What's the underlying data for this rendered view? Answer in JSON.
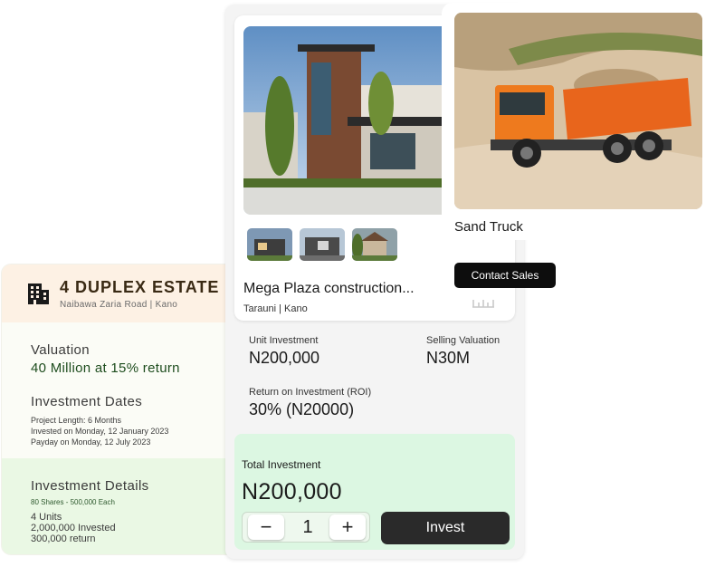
{
  "estate": {
    "title": "4 DUPLEX ESTATE",
    "subtitle": "Naibawa Zaria Road | Kano",
    "icon": "building-icon",
    "valuation_label": "Valuation",
    "valuation_value": "40 Million at 15% return",
    "dates_label": "Investment Dates",
    "project_length": "Project Length: 6 Months",
    "invested_on": "Invested on Monday, 12 January 2023",
    "payday": "Payday on Monday, 12 July 2023",
    "details_label": "Investment Details",
    "shares": "80 Shares -  500,000 Each",
    "units": "4 Units",
    "invested": "2,000,000 Invested",
    "return": "300,000 return"
  },
  "product": {
    "name": "Mega Plaza construction...",
    "location": "Tarauni | Kano",
    "unit_investment_label": "Unit Investment",
    "unit_investment_value": "N200,000",
    "selling_valuation_label": "Selling Valuation",
    "selling_valuation_value": "N30M",
    "roi_label": "Return on Investment (ROI)",
    "roi_value": "30% (N20000)",
    "total_label": "Total Investment",
    "total_value": "N200,000",
    "quantity": "1",
    "minus": "−",
    "plus": "+",
    "invest_button": "Invest"
  },
  "truck": {
    "name": "Sand Truck",
    "contact_button": "Contact Sales"
  },
  "colors": {
    "estate_header": "#fdf1e4",
    "details_bg": "#eaf8e4",
    "total_bg": "#dcf7e2",
    "dark_button": "#2a2a2a"
  }
}
